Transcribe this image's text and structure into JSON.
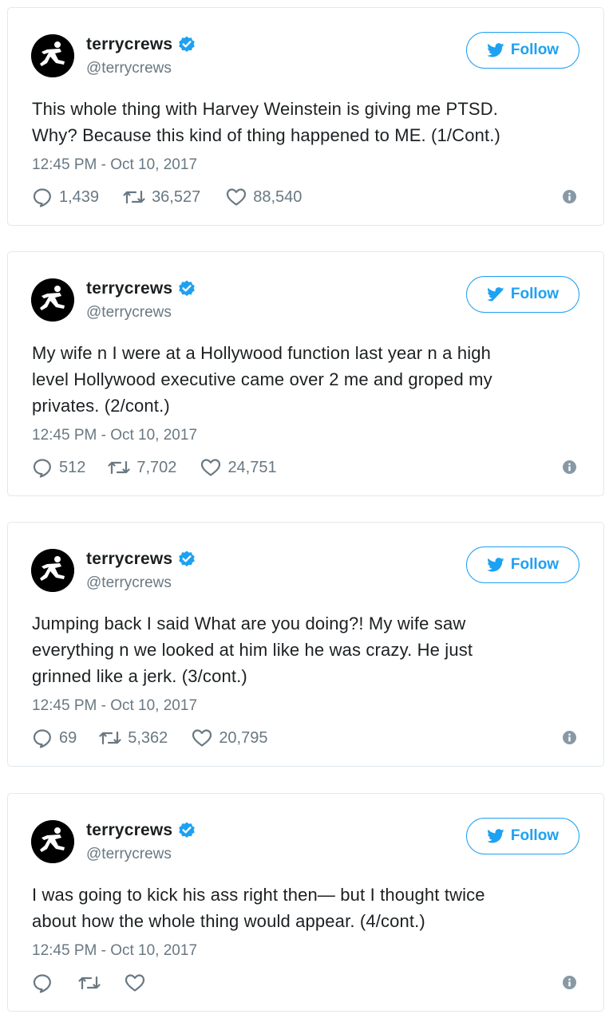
{
  "colors": {
    "accent": "#1da1f2",
    "muted": "#697882",
    "text": "#1c2022",
    "border": "#e1e8ed"
  },
  "icons": {
    "follow": "twitter-bird-icon",
    "verified": "verified-badge-icon",
    "reply": "reply-icon",
    "retweet": "retweet-icon",
    "like": "heart-icon",
    "info": "info-icon"
  },
  "tweets": [
    {
      "display_name": "terrycrews",
      "handle": "@terrycrews",
      "follow_label": "Follow",
      "text_lines": [
        "This whole thing with Harvey Weinstein is giving me PTSD.",
        "Why? Because this kind of thing happened to ME. (1/Cont.)"
      ],
      "timestamp": "12:45 PM - Oct 10, 2017",
      "replies": "1,439",
      "retweets": "36,527",
      "likes": "88,540"
    },
    {
      "display_name": "terrycrews",
      "handle": "@terrycrews",
      "follow_label": "Follow",
      "text_lines": [
        "My wife n I were at a Hollywood function last year n a high",
        "level Hollywood executive came over 2 me and groped my",
        "privates. (2/cont.)"
      ],
      "timestamp": "12:45 PM - Oct 10, 2017",
      "replies": "512",
      "retweets": "7,702",
      "likes": "24,751"
    },
    {
      "display_name": "terrycrews",
      "handle": "@terrycrews",
      "follow_label": "Follow",
      "text_lines": [
        "Jumping back I said What are you doing?! My wife saw",
        "everything n we looked at him like he was crazy. He just",
        "grinned like a jerk. (3/cont.)"
      ],
      "timestamp": "12:45 PM - Oct 10, 2017",
      "replies": "69",
      "retweets": "5,362",
      "likes": "20,795"
    },
    {
      "display_name": "terrycrews",
      "handle": "@terrycrews",
      "follow_label": "Follow",
      "text_lines": [
        "I was going to kick his ass right then— but I thought twice",
        "about how the whole thing would appear. (4/cont.)"
      ],
      "timestamp": "12:45 PM - Oct 10, 2017",
      "replies": "",
      "retweets": "",
      "likes": ""
    }
  ]
}
